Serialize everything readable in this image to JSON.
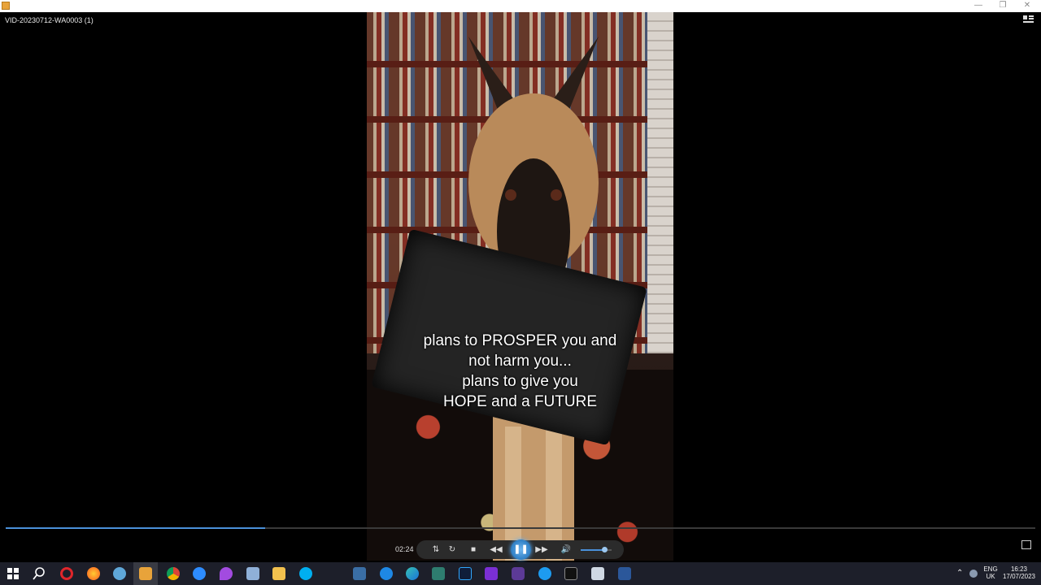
{
  "window": {
    "title": "VID-20230712-WA0003 (1)"
  },
  "video": {
    "caption_lines": [
      "plans to PROSPER you and",
      "not harm you...",
      "plans to give you",
      "HOPE and a FUTURE"
    ],
    "progress_fraction": 0.252
  },
  "controls": {
    "elapsed": "02:24",
    "volume_fraction": 0.75
  },
  "tray": {
    "language_top": "ENG",
    "language_bottom": "UK",
    "time": "16:23",
    "date": "17/07/2023"
  },
  "colors": {
    "accent": "#4a90d9",
    "taskbar": "#1d1f2a"
  },
  "taskbar_icons": [
    "windows-start-icon",
    "search-icon",
    "opera-icon",
    "firefox-icon",
    "network-icon",
    "media-player-icon",
    "chrome-icon",
    "zoom-icon",
    "drop-icon",
    "pen-icon",
    "file-explorer-icon",
    "skype-icon",
    "app-icon",
    "edge-legacy-icon",
    "edge-icon",
    "terminal-icon",
    "photoshop-icon",
    "app-purple-icon",
    "vpn-icon",
    "messaging-icon",
    "console-icon",
    "notepad-icon",
    "word-icon"
  ]
}
